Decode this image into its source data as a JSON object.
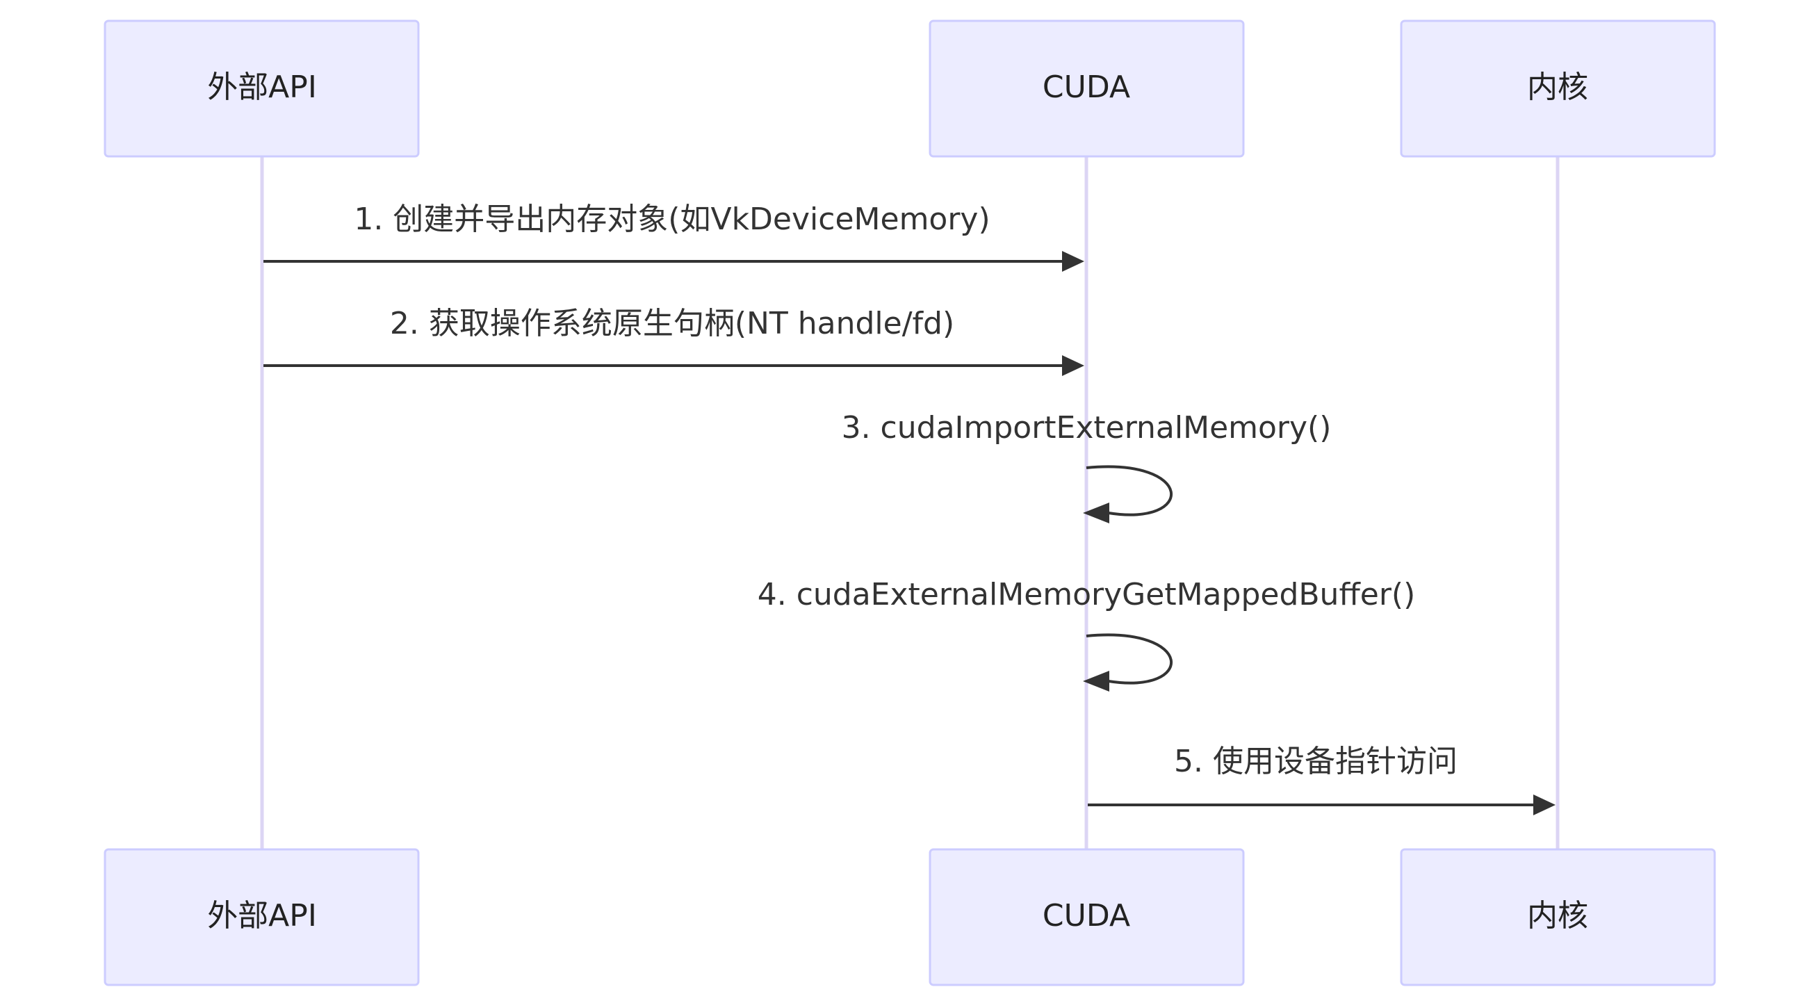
{
  "diagram": {
    "type": "sequence",
    "participants": [
      {
        "id": "ext",
        "label": "外部API"
      },
      {
        "id": "cuda",
        "label": "CUDA"
      },
      {
        "id": "kernel",
        "label": "内核"
      }
    ],
    "messages": [
      {
        "from": "ext",
        "to": "cuda",
        "label": "1. 创建并导出内存对象(如VkDeviceMemory)"
      },
      {
        "from": "ext",
        "to": "cuda",
        "label": "2. 获取操作系统原生句柄(NT handle/fd)"
      },
      {
        "from": "cuda",
        "to": "cuda",
        "label": "3. cudaImportExternalMemory()"
      },
      {
        "from": "cuda",
        "to": "cuda",
        "label": "4. cudaExternalMemoryGetMappedBuffer()"
      },
      {
        "from": "cuda",
        "to": "kernel",
        "label": "5. 使用设备指针访问"
      }
    ]
  },
  "colors": {
    "actor_fill": "#ECECFF",
    "actor_border": "#CCCCFF",
    "lifeline": "#DCD5F4",
    "arrow": "#333333",
    "text": "#222222"
  }
}
